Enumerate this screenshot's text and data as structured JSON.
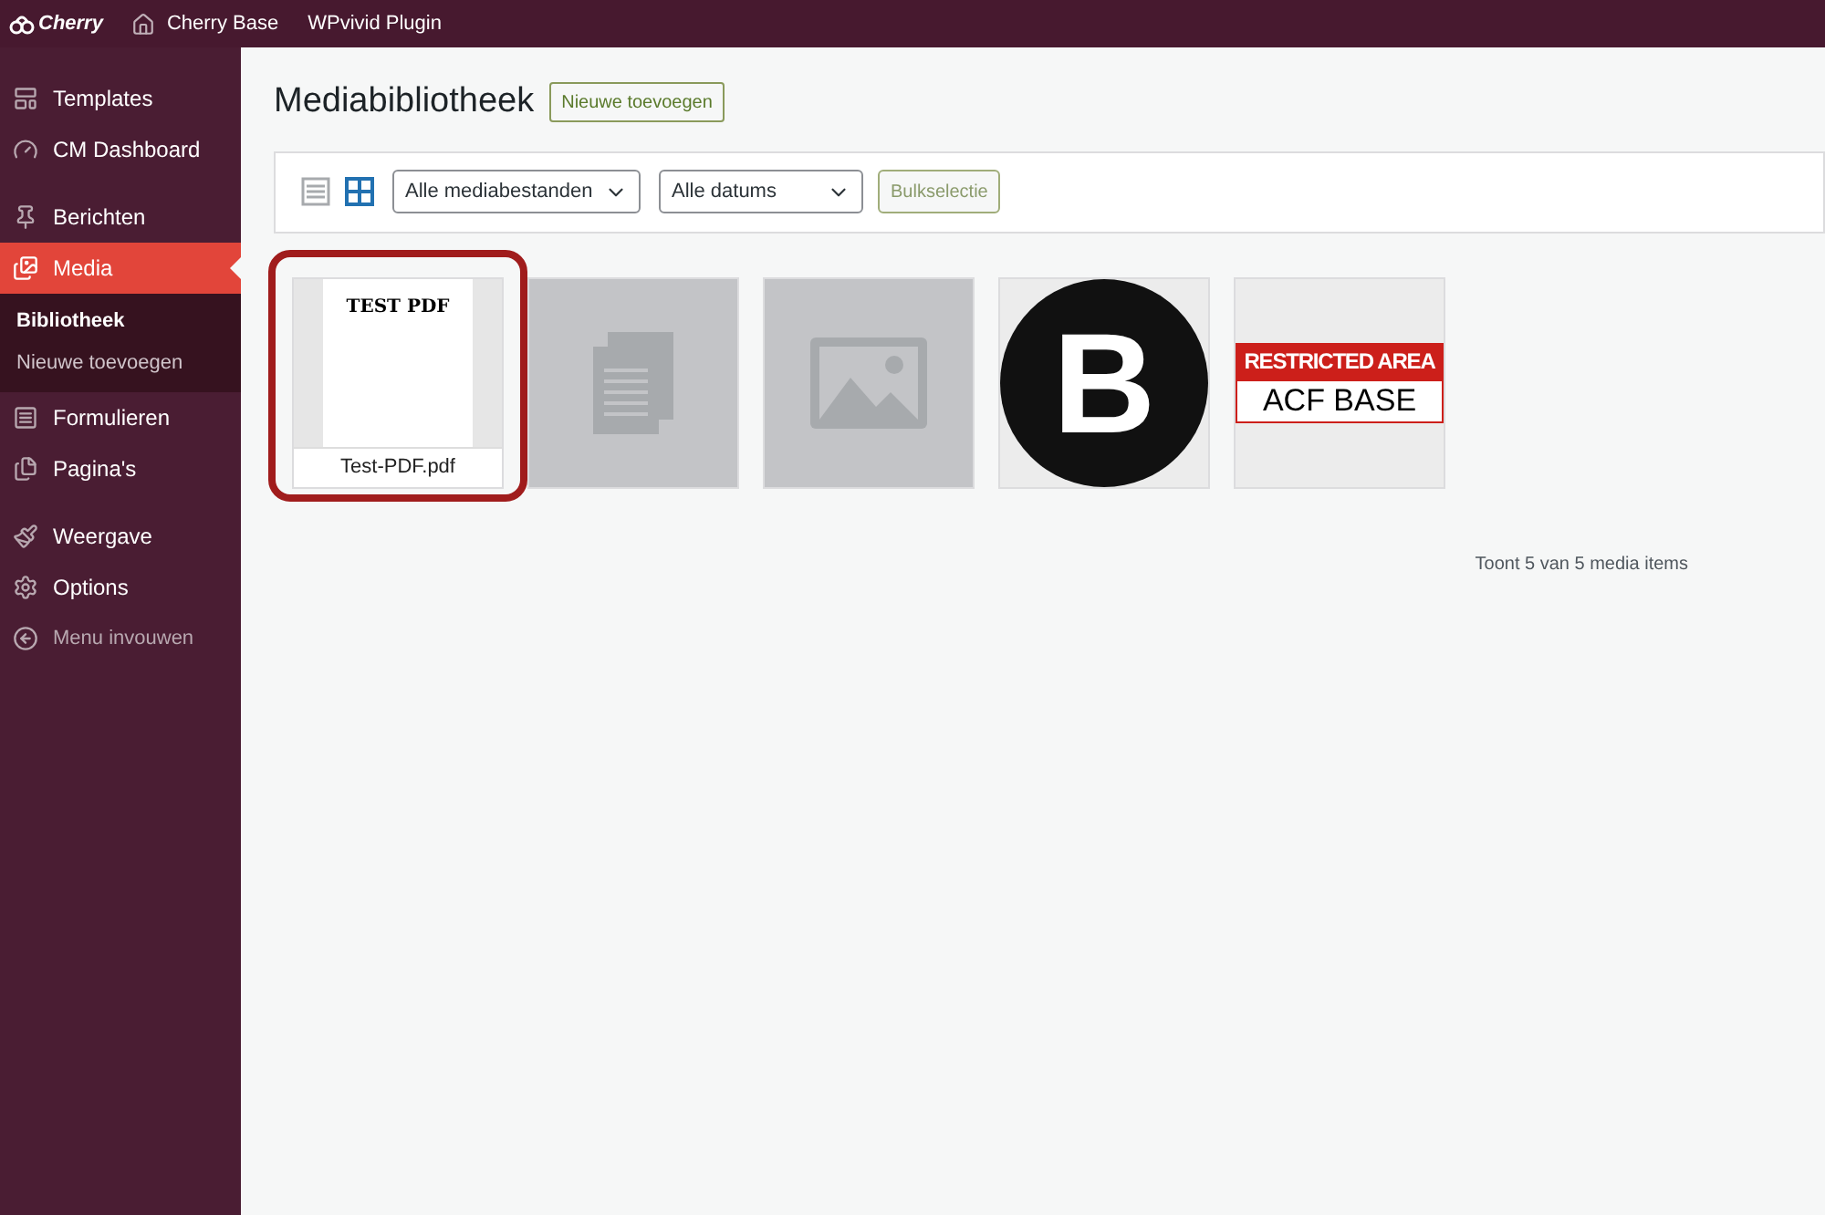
{
  "top_bar": {
    "logo": "Cherry",
    "items": [
      {
        "label": "Cherry Base"
      },
      {
        "label": "WPvivid Plugin"
      }
    ]
  },
  "sidebar": {
    "groups": [
      {
        "items": [
          {
            "label": "Templates",
            "selected": false
          },
          {
            "label": "CM Dashboard",
            "selected": false
          }
        ]
      },
      {
        "items": [
          {
            "label": "Berichten",
            "selected": false
          },
          {
            "label": "Media",
            "selected": true,
            "children": [
              {
                "label": "Bibliotheek",
                "selected": true
              },
              {
                "label": "Nieuwe toevoegen",
                "selected": false
              }
            ]
          },
          {
            "label": "Formulieren",
            "selected": false
          },
          {
            "label": "Pagina's",
            "selected": false
          }
        ]
      },
      {
        "items": [
          {
            "label": "Weergave",
            "selected": false
          },
          {
            "label": "Options",
            "selected": false
          },
          {
            "label": "Menu invouwen",
            "selected": false,
            "kind": "collapse"
          }
        ]
      }
    ]
  },
  "header": {
    "title": "Mediabibliotheek",
    "add_button": "Nieuwe toevoegen"
  },
  "toolbar": {
    "views": [
      {
        "selected": false
      },
      {
        "selected": true
      }
    ],
    "filters": [
      "Alle mediabestanden",
      "Alle datums"
    ],
    "bulk_button": "Bulkselectie"
  },
  "media": [
    {
      "kind": "pdf",
      "preview_text": "TEST PDF",
      "filename": "Test-PDF.pdf",
      "highlighted": true
    },
    {
      "kind": "document",
      "highlighted": false
    },
    {
      "kind": "image",
      "highlighted": false
    },
    {
      "kind": "logo",
      "letter": "B",
      "highlighted": false
    },
    {
      "kind": "banner",
      "top_text": "RESTRICTED AREA",
      "bottom_text": "ACF BASE",
      "highlighted": false
    }
  ],
  "status": "Toont 5 van 5 media items"
}
